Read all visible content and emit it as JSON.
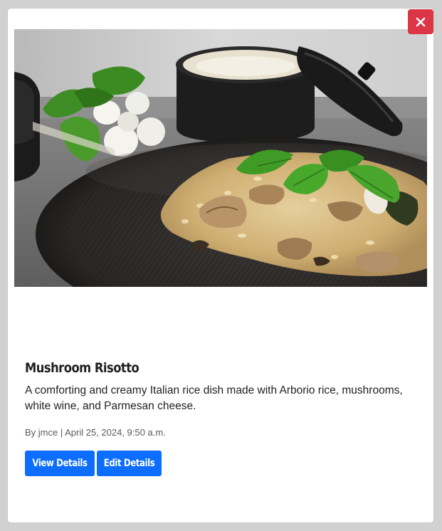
{
  "close": {
    "icon": "close-icon",
    "color": "#dc3545"
  },
  "recipe": {
    "image_alt": "Mushroom Risotto",
    "title": "Mushroom Risotto",
    "description": "A comforting and creamy Italian rice dish made with Arborio rice, mushrooms, white wine, and Parmesan cheese.",
    "meta": "By jmce | April 25, 2024, 9:50 a.m."
  },
  "actions": {
    "view_label": "View Details",
    "edit_label": "Edit Details",
    "color": "#0d6efd"
  }
}
